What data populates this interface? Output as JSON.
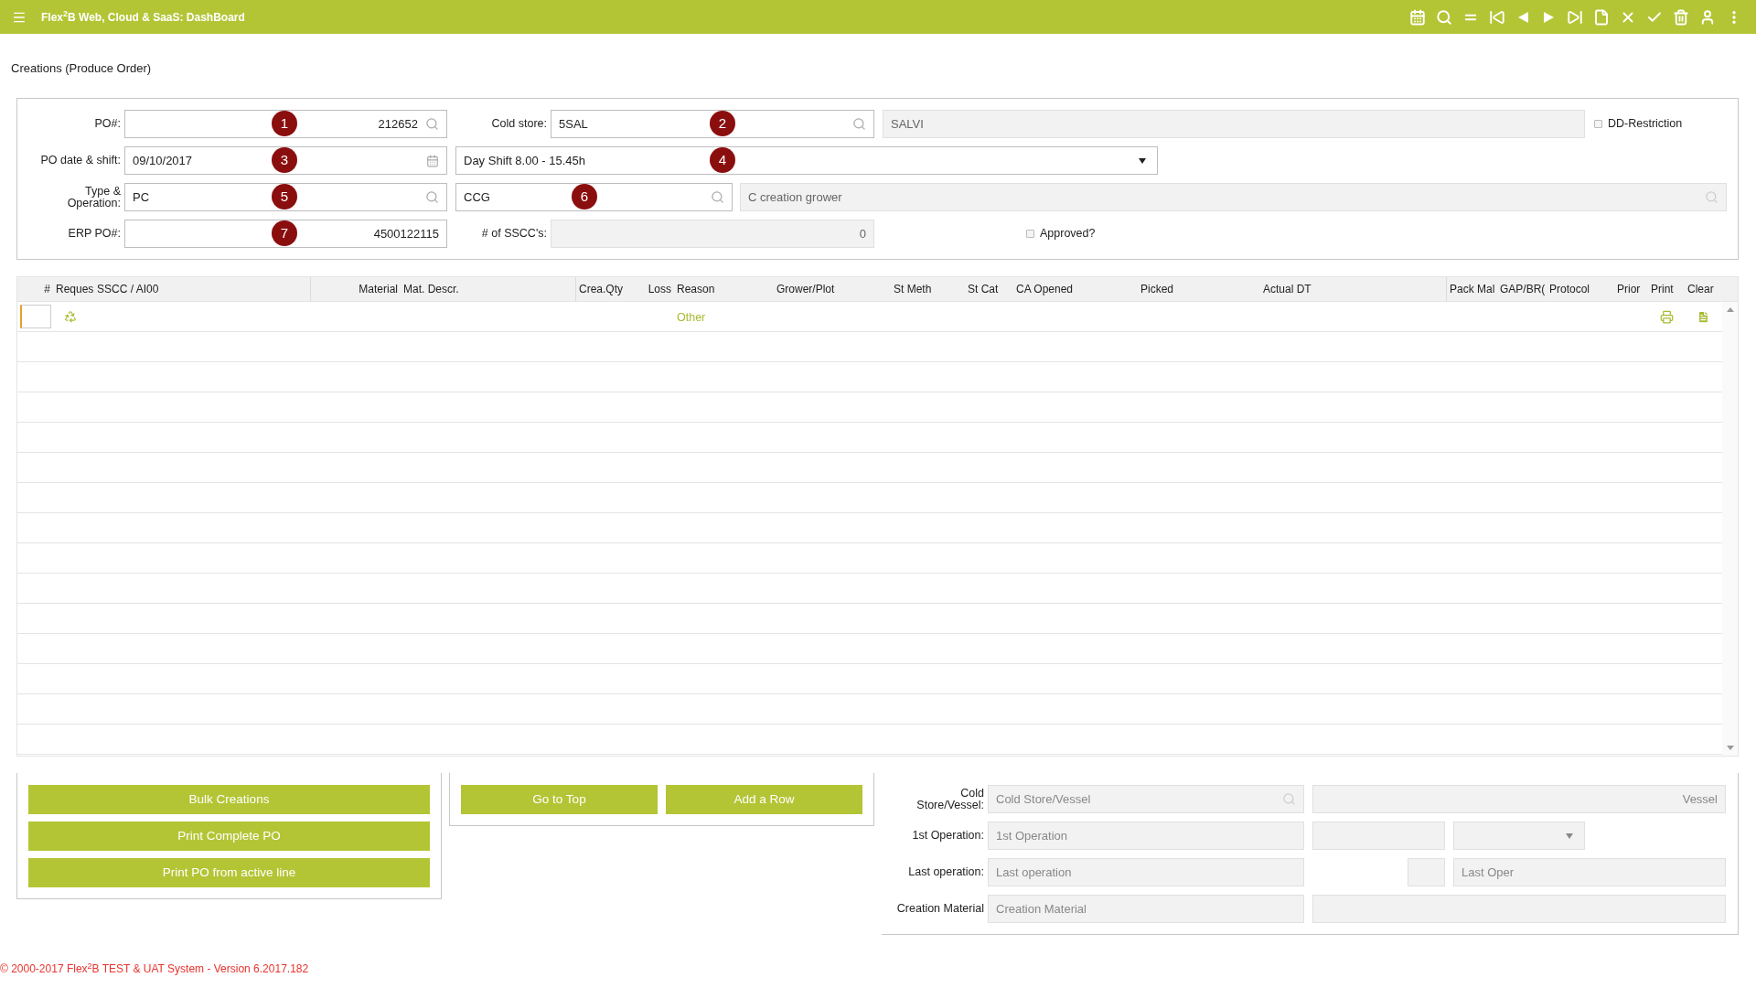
{
  "header": {
    "title": "Flex$^{2}$B Web, Cloud & SaaS: DashBoard"
  },
  "page_title": "Creations (Produce Order)",
  "form": {
    "po": {
      "label": "PO#:",
      "value": "212652",
      "marker": "1"
    },
    "cold_store": {
      "label": "Cold store:",
      "value": "5SAL",
      "marker": "2"
    },
    "cold_store_name": {
      "value": "SALVI"
    },
    "dd_restriction": {
      "label": "DD-Restriction",
      "checked": false
    },
    "po_date": {
      "label": "PO date & shift:",
      "value": "09/10/2017",
      "marker": "3"
    },
    "shift": {
      "value": "Day Shift 8.00 - 15.45h",
      "marker": "4"
    },
    "type": {
      "label": "Type & Operation:",
      "value": "PC",
      "marker": "5"
    },
    "operation": {
      "value": "CCG",
      "marker": "6"
    },
    "operation_name": {
      "value": "C creation grower"
    },
    "erp_po": {
      "label": "ERP PO#:",
      "value": "4500122115",
      "marker": "7"
    },
    "sscc_count": {
      "label": "# of SSCC's:",
      "value": "0"
    },
    "approved": {
      "label": "Approved?",
      "checked": false
    }
  },
  "table": {
    "columns": [
      "#",
      "Reques",
      "SSCC / AI00",
      "Material",
      "Mat. Descr.",
      "Crea.Qty",
      "Loss",
      "Reason",
      "Grower/Plot",
      "St Meth",
      "St Cat",
      "CA Opened",
      "Picked",
      "Actual DT",
      "Pack Mal",
      "GAP/BR(",
      "Protocol",
      "Prior",
      "Print",
      "Clear"
    ],
    "rows": [
      {
        "reason": "Other"
      }
    ]
  },
  "actions_left": [
    "Bulk Creations",
    "Print Complete PO",
    "Print PO from active line"
  ],
  "actions_middle": [
    "Go to Top",
    "Add a Row"
  ],
  "details": {
    "cold_store_vessel": {
      "label": "Cold Store/Vessel:",
      "placeholder": "Cold Store/Vessel"
    },
    "vessel": {
      "placeholder": "Vessel"
    },
    "first_operation": {
      "label": "1st Operation:",
      "placeholder": "1st Operation"
    },
    "last_operation": {
      "label": "Last operation:",
      "placeholder": "Last operation"
    },
    "last_oper": {
      "placeholder": "Last Oper"
    },
    "creation_material": {
      "label": "Creation Material",
      "placeholder": "Creation Material"
    }
  },
  "footer": "© 2000-2017 Flex$^{2}$B TEST & UAT System - Version 6.2017.182"
}
